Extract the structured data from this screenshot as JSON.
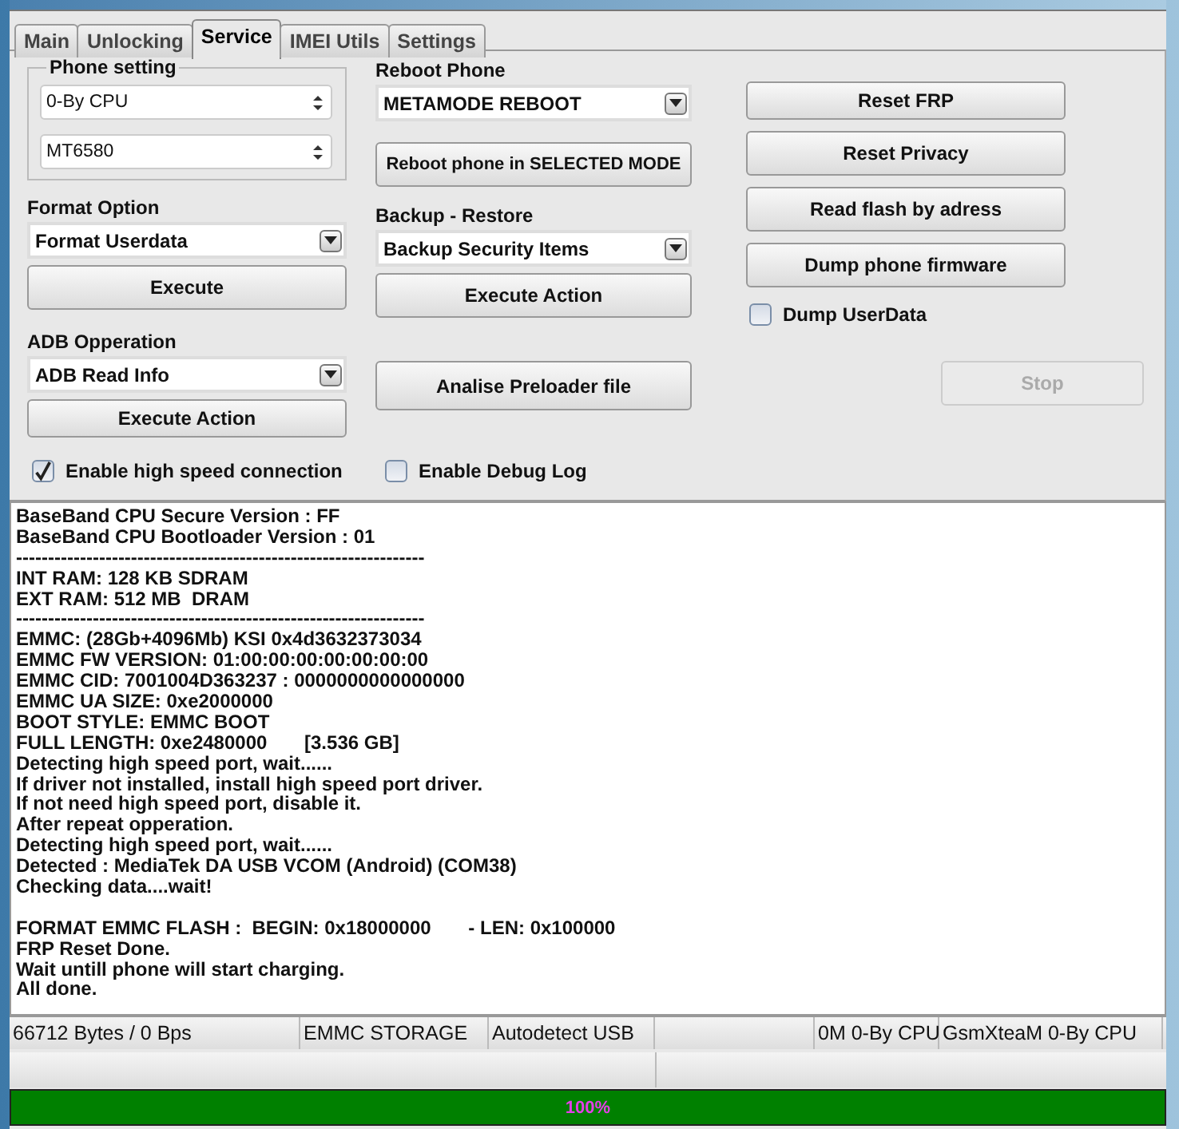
{
  "tabs": [
    {
      "label": "Main",
      "selected": false
    },
    {
      "label": "Unlocking",
      "selected": false
    },
    {
      "label": "Service",
      "selected": true
    },
    {
      "label": "IMEI Utils",
      "selected": false
    },
    {
      "label": "Settings",
      "selected": false
    }
  ],
  "phone_setting": {
    "title": "Phone setting",
    "vendor": "0-By CPU",
    "chipset": "MT6580"
  },
  "format_option": {
    "label": "Format Option",
    "value": "Format Userdata",
    "button": "Execute"
  },
  "adb_operation": {
    "label": "ADB Opperation",
    "value": "ADB Read Info",
    "button": "Execute Action"
  },
  "reboot_phone": {
    "label": "Reboot Phone",
    "value": "METAMODE REBOOT",
    "button": "Reboot phone in SELECTED MODE"
  },
  "backup_restore": {
    "label": "Backup - Restore",
    "value": "Backup Security Items",
    "button": "Execute Action"
  },
  "analyse_button": "Analise Preloader file",
  "right_buttons": [
    "Reset FRP",
    "Reset Privacy",
    "Read flash by adress",
    "Dump phone firmware"
  ],
  "dump_userdata": {
    "label": "Dump UserData",
    "checked": false
  },
  "stop_button": {
    "label": "Stop",
    "disabled": true
  },
  "options": [
    {
      "label": "Enable high speed connection",
      "checked": true
    },
    {
      "label": "Enable Debug Log",
      "checked": false
    }
  ],
  "log_blocks": [
    [
      "BaseBand CPU Secure Version : FF",
      "BaseBand CPU Bootloader Version : 01",
      "----------------------------------------------------------------",
      "INT RAM: 128 KB SDRAM",
      "EXT RAM: 512 MB  DRAM",
      "----------------------------------------------------------------",
      "EMMC: (28Gb+4096Mb) KSI 0x4d3632373034",
      "EMMC FW VERSION: 01:00:00:00:00:00:00:00",
      "EMMC CID: 7001004D363237 : 0000000000000000",
      "EMMC UA SIZE: 0xe2000000",
      "BOOT STYLE: EMMC BOOT",
      "FULL LENGTH: 0xe2480000       [3.536 GB]",
      "Detecting high speed port, wait......",
      "If driver not installed, install high speed port driver.",
      "If not need high speed port, disable it.",
      "After repeat opperation.",
      "Detecting high speed port, wait......",
      "Detected : MediaTek DA USB VCOM (Android) (COM38)",
      "Checking data....wait!"
    ],
    [
      "FORMAT EMMC FLASH :  BEGIN: 0x18000000       - LEN: 0x100000",
      "FRP Reset Done.",
      "Wait untill phone will start charging.",
      "All done."
    ]
  ],
  "status_bar": [
    "66712 Bytes / 0 Bps",
    "EMMC STORAGE",
    "Autodetect USB",
    "0M 0-By CPU",
    "GsmXteaM 0-By CPU"
  ],
  "progress": {
    "level": 1,
    "text": "100%"
  }
}
